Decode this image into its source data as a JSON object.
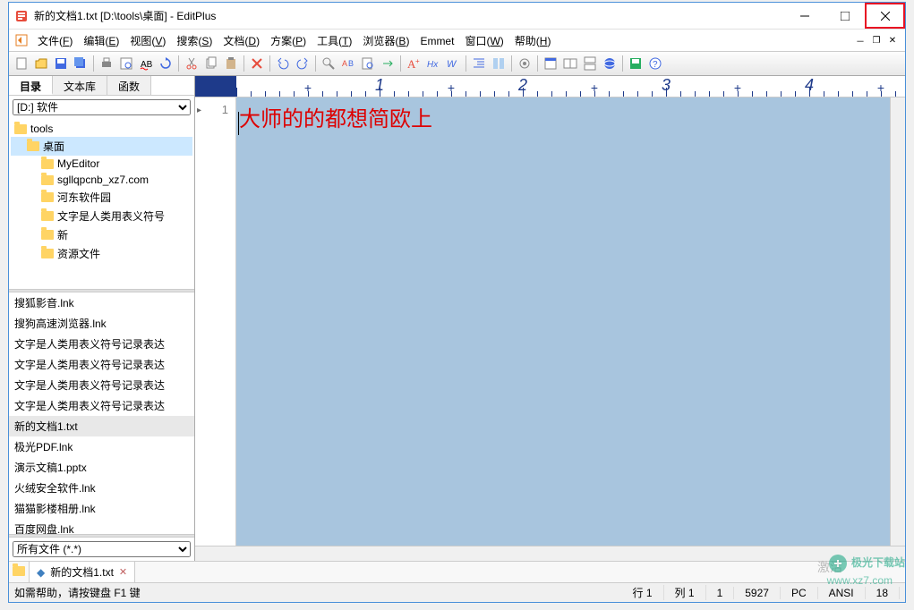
{
  "title": "新的文档1.txt [D:\\tools\\桌面] - EditPlus",
  "menus": [
    "文件(F)",
    "编辑(E)",
    "视图(V)",
    "搜索(S)",
    "文档(D)",
    "方案(P)",
    "工具(T)",
    "浏览器(B)",
    "Emmet",
    "窗口(W)",
    "帮助(H)"
  ],
  "sideTabs": {
    "dir": "目录",
    "lib": "文本库",
    "func": "函数"
  },
  "drive": "[D:] 软件",
  "folders": [
    {
      "name": "tools",
      "indent": 0,
      "selected": false
    },
    {
      "name": "桌面",
      "indent": 1,
      "selected": true
    },
    {
      "name": "MyEditor",
      "indent": 2
    },
    {
      "name": "sgllqpcnb_xz7.com",
      "indent": 2
    },
    {
      "name": "河东软件园",
      "indent": 2
    },
    {
      "name": "文字是人类用表义符号",
      "indent": 2
    },
    {
      "name": "新",
      "indent": 2
    },
    {
      "name": "资源文件",
      "indent": 2
    }
  ],
  "files": [
    "搜狐影音.lnk",
    "搜狗高速浏览器.lnk",
    "文字是人类用表义符号记录表达",
    "文字是人类用表义符号记录表达",
    "文字是人类用表义符号记录表达",
    "文字是人类用表义符号记录表达",
    "新的文档1.txt",
    "极光PDF.lnk",
    "演示文稿1.pptx",
    "火绒安全软件.lnk",
    "猫猫影楼相册.lnk",
    "百度网盘.lnk"
  ],
  "selectedFile": "新的文档1.txt",
  "fileFilter": "所有文件 (*.*)",
  "editorText": "大师的的都想简欧上",
  "lineNumber": "1",
  "rulerNumbers": [
    "1",
    "2",
    "3",
    "4"
  ],
  "docTab": {
    "name": "新的文档1.txt",
    "modified": true
  },
  "status": {
    "help": "如需帮助，请按键盘 F1 键",
    "line": "行 1",
    "col": "列 1",
    "sel": "1",
    "size": "5927",
    "mode": "PC",
    "encoding": "ANSI",
    "extra": "18"
  },
  "activate": "激活",
  "watermark": {
    "brand": "极光下载站",
    "url": "www.xz7.com"
  }
}
